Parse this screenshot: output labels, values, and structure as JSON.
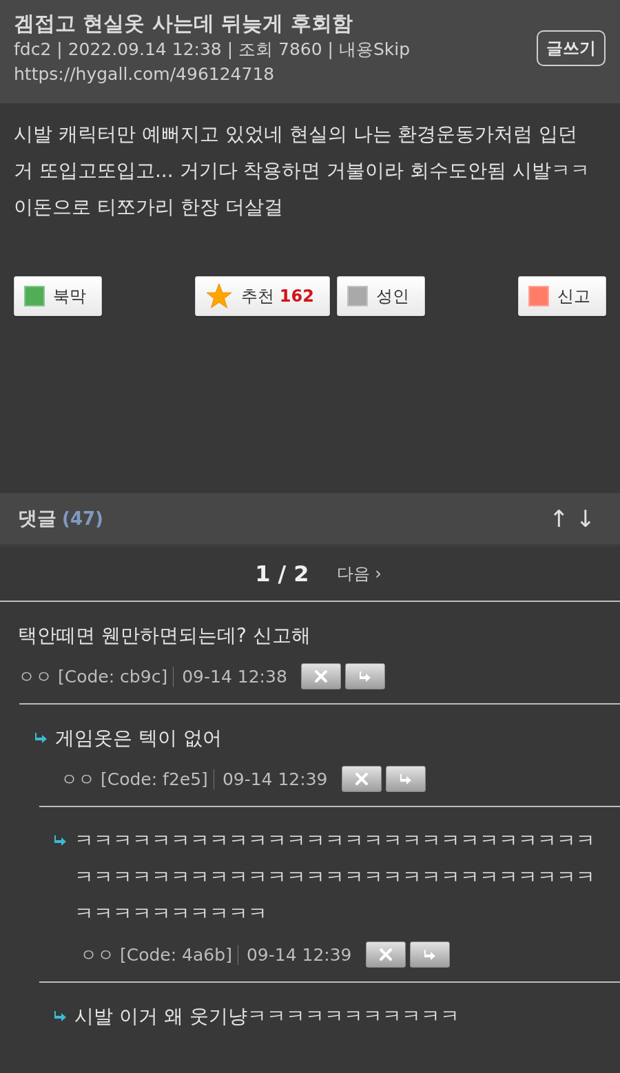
{
  "post": {
    "title": "겜접고 현실옷 사는데 뒤늦게 후회함",
    "meta": "fdc2 | 2022.09.14 12:38 | 조회 7860 | 내용Skip",
    "url": "https://hygall.com/496124718",
    "write_button": "글쓰기",
    "body": "시발 캐릭터만 예뻐지고 있었네 현실의 나는 환경운동가처럼 입던 거 또입고또입고... 거기다 착용하면 거불이라 회수도안됨 시발ㅋㅋ 이돈으로 티쪼가리 한장 더살걸"
  },
  "actions": {
    "left": [
      {
        "label": "북막",
        "kind": "square",
        "color": "#52ad57"
      }
    ],
    "center": [
      {
        "label": "추천",
        "count": "162",
        "kind": "star"
      },
      {
        "label": "성인",
        "kind": "square",
        "color": "#a9a9a9"
      }
    ],
    "right": [
      {
        "label": "신고",
        "kind": "square",
        "color": "#ff7d67"
      }
    ]
  },
  "comments_header": {
    "label": "댓글",
    "count": "(47)",
    "sort_up": "↑",
    "sort_down": "↓"
  },
  "pagination": {
    "current": "1 / 2",
    "next": "다음 ›"
  },
  "comments": [
    {
      "text": "택안떼면 웬만하면되는데? 신고해",
      "author": "ㅇㅇ",
      "code": "[Code: cb9c]",
      "time": "09-14 12:38",
      "children": [
        {
          "text": "게임옷은 텍이 없어",
          "author": "ㅇㅇ",
          "code": "[Code: f2e5]",
          "time": "09-14 12:39",
          "children": [
            {
              "text": "ㅋㅋㅋㅋㅋㅋㅋㅋㅋㅋㅋㅋㅋㅋㅋㅋㅋㅋㅋㅋㅋㅋㅋㅋㅋㅋㅋㅋㅋㅋㅋㅋㅋㅋㅋㅋㅋㅋㅋㅋㅋㅋㅋㅋㅋㅋㅋㅋㅋㅋㅋㅋㅋㅋㅋㅋㅋㅋㅋㅋㅋㅋㅋㅋ",
              "author": "ㅇㅇ",
              "code": "[Code: 4a6b]",
              "time": "09-14 12:39"
            },
            {
              "text": "시발 이거 왜 웃기냥ㅋㅋㅋㅋㅋㅋㅋㅋㅋㅋㅋ"
            }
          ]
        }
      ]
    }
  ]
}
